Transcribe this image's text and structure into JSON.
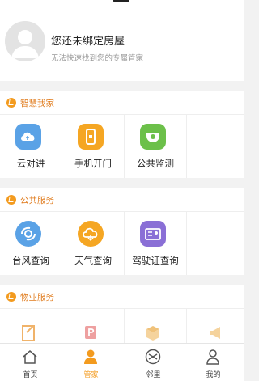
{
  "profile": {
    "title": "您还未绑定房屋",
    "subtitle": "无法快速找到您的专属管家"
  },
  "sections": [
    {
      "title": "智慧我家",
      "items": [
        {
          "label": "云对讲",
          "icon": "cloud-intercom-icon",
          "color": "#5aa2e6"
        },
        {
          "label": "手机开门",
          "icon": "phone-unlock-icon",
          "color": "#f5a623"
        },
        {
          "label": "公共监测",
          "icon": "camera-monitor-icon",
          "color": "#6cc04a"
        }
      ]
    },
    {
      "title": "公共服务",
      "items": [
        {
          "label": "台风查询",
          "icon": "typhoon-icon",
          "color": "#5aa2e6"
        },
        {
          "label": "天气查询",
          "icon": "weather-cloud-icon",
          "color": "#f5a623"
        },
        {
          "label": "驾驶证查询",
          "icon": "license-card-icon",
          "color": "#8a6fd6"
        }
      ]
    },
    {
      "title": "物业服务",
      "items": [
        {
          "label": "",
          "icon": "notebook-icon",
          "color": "#f5a623"
        },
        {
          "label": "",
          "icon": "parking-icon",
          "color": "#e57373"
        },
        {
          "label": "",
          "icon": "package-icon",
          "color": "#f5a623"
        },
        {
          "label": "",
          "icon": "megaphone-icon",
          "color": "#f5a623"
        }
      ]
    }
  ],
  "tabbar": {
    "items": [
      {
        "label": "首页",
        "icon": "home-icon",
        "active": false
      },
      {
        "label": "管家",
        "icon": "butler-icon",
        "active": true
      },
      {
        "label": "邻里",
        "icon": "neighbor-icon",
        "active": false
      },
      {
        "label": "我的",
        "icon": "user-icon",
        "active": false
      }
    ],
    "active_color": "#f39b1f"
  }
}
